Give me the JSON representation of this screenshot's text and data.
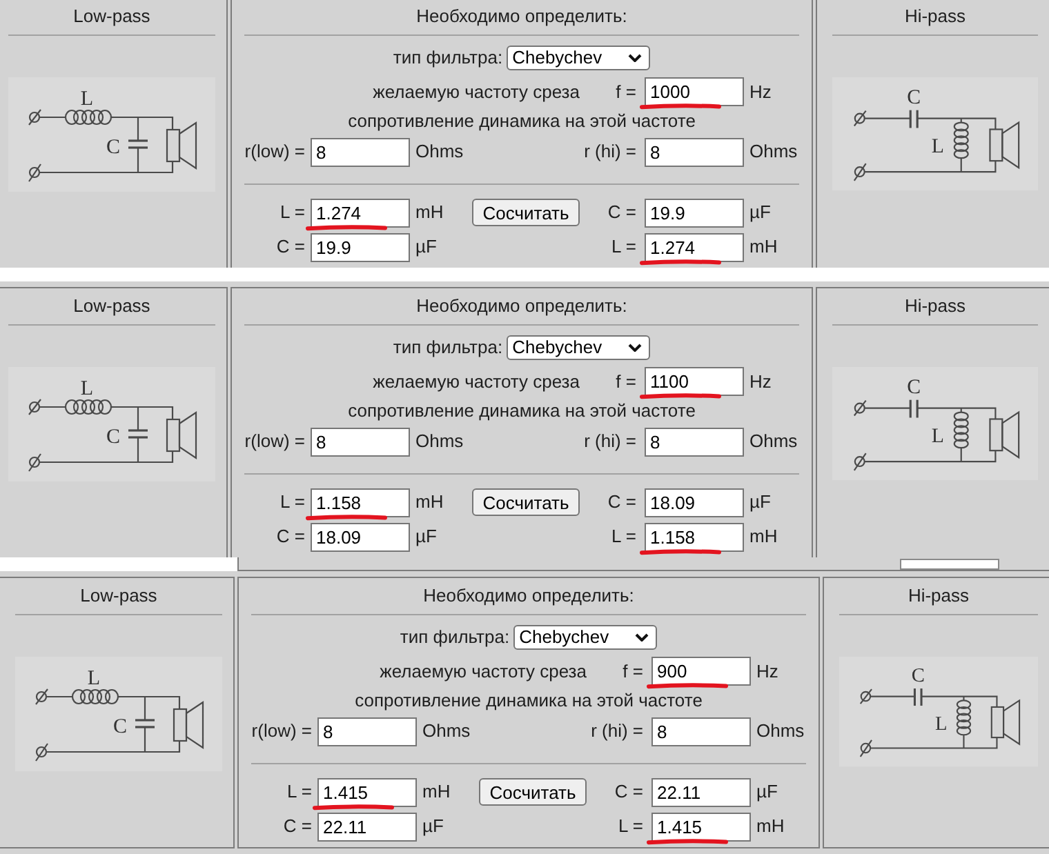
{
  "screens": [
    {
      "low_pass": {
        "title": "Low-pass",
        "diagram": {
          "inductor_label": "L",
          "capacitor_label": "C"
        }
      },
      "calculator": {
        "title": "Необходимо определить:",
        "filter_type": {
          "label": "тип фильтра:",
          "value": "Chebychev"
        },
        "cutoff": {
          "caption": "желаемую частоту среза",
          "label": "f =",
          "value": "1000",
          "unit": "Hz",
          "underlined": true
        },
        "impedance_caption": "сопротивление динамика на этой частоте",
        "r_low": {
          "label": "r(low) =",
          "value": "8",
          "unit": "Ohms",
          "underlined": false
        },
        "r_hi": {
          "label": "r (hi) =",
          "value": "8",
          "unit": "Ohms",
          "underlined": false
        },
        "button": "Сосчитать",
        "low_results": [
          {
            "label": "L =",
            "value": "1.274",
            "unit": "mH",
            "underlined": true
          },
          {
            "label": "C =",
            "value": "19.9",
            "unit": "µF",
            "underlined": false
          }
        ],
        "hi_results": [
          {
            "label": "C =",
            "value": "19.9",
            "unit": "µF",
            "underlined": false
          },
          {
            "label": "L =",
            "value": "1.274",
            "unit": "mH",
            "underlined": true
          }
        ]
      },
      "hi_pass": {
        "title": "Hi-pass",
        "diagram": {
          "capacitor_label": "C",
          "inductor_label": "L"
        }
      }
    },
    {
      "low_pass": {
        "title": "Low-pass",
        "diagram": {
          "inductor_label": "L",
          "capacitor_label": "C"
        }
      },
      "calculator": {
        "title": "Необходимо определить:",
        "filter_type": {
          "label": "тип фильтра:",
          "value": "Chebychev"
        },
        "cutoff": {
          "caption": "желаемую частоту среза",
          "label": "f =",
          "value": "1100",
          "unit": "Hz",
          "underlined": true
        },
        "impedance_caption": "сопротивление динамика на этой частоте",
        "r_low": {
          "label": "r(low) =",
          "value": "8",
          "unit": "Ohms",
          "underlined": false
        },
        "r_hi": {
          "label": "r (hi) =",
          "value": "8",
          "unit": "Ohms",
          "underlined": false
        },
        "button": "Сосчитать",
        "low_results": [
          {
            "label": "L =",
            "value": "1.158",
            "unit": "mH",
            "underlined": true
          },
          {
            "label": "C =",
            "value": "18.09",
            "unit": "µF",
            "underlined": false
          }
        ],
        "hi_results": [
          {
            "label": "C =",
            "value": "18.09",
            "unit": "µF",
            "underlined": false
          },
          {
            "label": "L =",
            "value": "1.158",
            "unit": "mH",
            "underlined": true
          }
        ]
      },
      "hi_pass": {
        "title": "Hi-pass",
        "diagram": {
          "capacitor_label": "C",
          "inductor_label": "L"
        }
      }
    },
    {
      "low_pass": {
        "title": "Low-pass",
        "diagram": {
          "inductor_label": "L",
          "capacitor_label": "C"
        }
      },
      "calculator": {
        "title": "Необходимо определить:",
        "filter_type": {
          "label": "тип фильтра:",
          "value": "Chebychev"
        },
        "cutoff": {
          "caption": "желаемую частоту среза",
          "label": "f =",
          "value": "900",
          "unit": "Hz",
          "underlined": true
        },
        "impedance_caption": "сопротивление динамика на этой частоте",
        "r_low": {
          "label": "r(low) =",
          "value": "8",
          "unit": "Ohms",
          "underlined": false
        },
        "r_hi": {
          "label": "r (hi) =",
          "value": "8",
          "unit": "Ohms",
          "underlined": false
        },
        "button": "Сосчитать",
        "low_results": [
          {
            "label": "L =",
            "value": "1.415",
            "unit": "mH",
            "underlined": true
          },
          {
            "label": "C =",
            "value": "22.11",
            "unit": "µF",
            "underlined": false
          }
        ],
        "hi_results": [
          {
            "label": "C =",
            "value": "22.11",
            "unit": "µF",
            "underlined": false
          },
          {
            "label": "L =",
            "value": "1.415",
            "unit": "mH",
            "underlined": true
          }
        ]
      },
      "hi_pass": {
        "title": "Hi-pass",
        "diagram": {
          "capacitor_label": "C",
          "inductor_label": "L"
        }
      }
    }
  ]
}
